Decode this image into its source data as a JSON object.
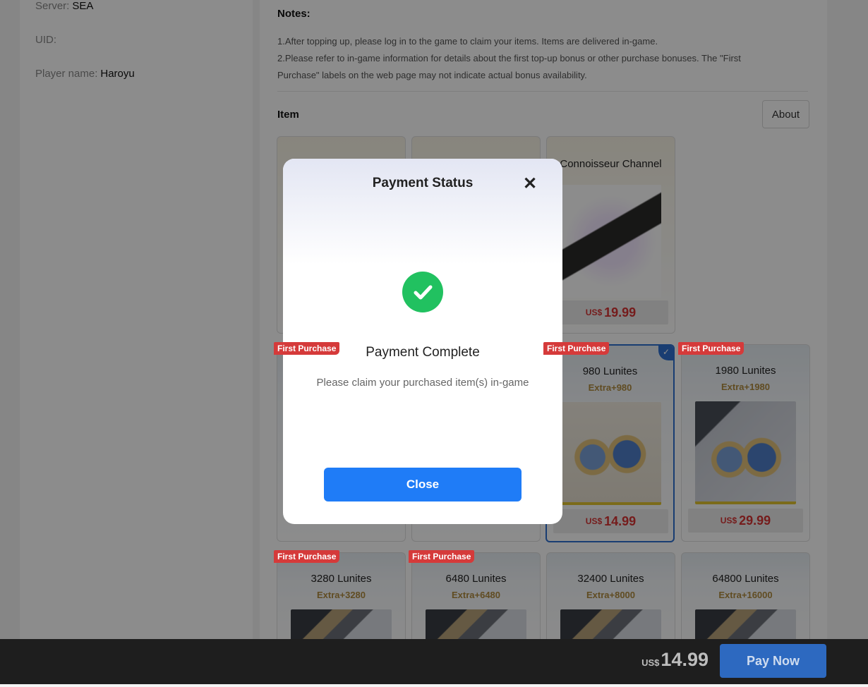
{
  "player": {
    "server_label": "Server:",
    "server_value": "SEA",
    "uid_label": "UID:",
    "uid_value": "",
    "name_label": "Player name:",
    "name_value": "Haroyu"
  },
  "notes": {
    "title": "Notes:",
    "line1": "1.After topping up, please log in to the game to claim your items. Items are delivered in-game.",
    "line2": "2.Please refer to in-game information for details about the first top-up bonus or other purchase bonuses. The \"First",
    "line3": "Purchase\" labels on the web page may not indicate actual bonus availability."
  },
  "items": {
    "title": "Item",
    "about_label": "About",
    "badge_label": "First Purchase",
    "cards": [
      {
        "name": "Connoisseur Channel",
        "price_currency": "US$",
        "price": "19.99"
      },
      {
        "name": "980 Lunites",
        "extra": "Extra+980",
        "price_currency": "US$",
        "price": "14.99"
      },
      {
        "name": "1980 Lunites",
        "extra": "Extra+1980",
        "price_currency": "US$",
        "price": "29.99"
      },
      {
        "name": "3280 Lunites",
        "extra": "Extra+3280"
      },
      {
        "name": "6480 Lunites",
        "extra": "Extra+6480"
      },
      {
        "name": "32400 Lunites",
        "extra": "Extra+8000"
      },
      {
        "name": "64800 Lunites",
        "extra": "Extra+16000"
      }
    ]
  },
  "bottom_bar": {
    "currency": "US$",
    "total": "14.99",
    "pay_label": "Pay Now"
  },
  "modal": {
    "title": "Payment Status",
    "close_icon": "close-icon",
    "status": "Payment Complete",
    "message": "Please claim your purchased item(s) in-game",
    "button_label": "Close",
    "success_color": "#21c160",
    "button_color": "#1f7cf7"
  }
}
